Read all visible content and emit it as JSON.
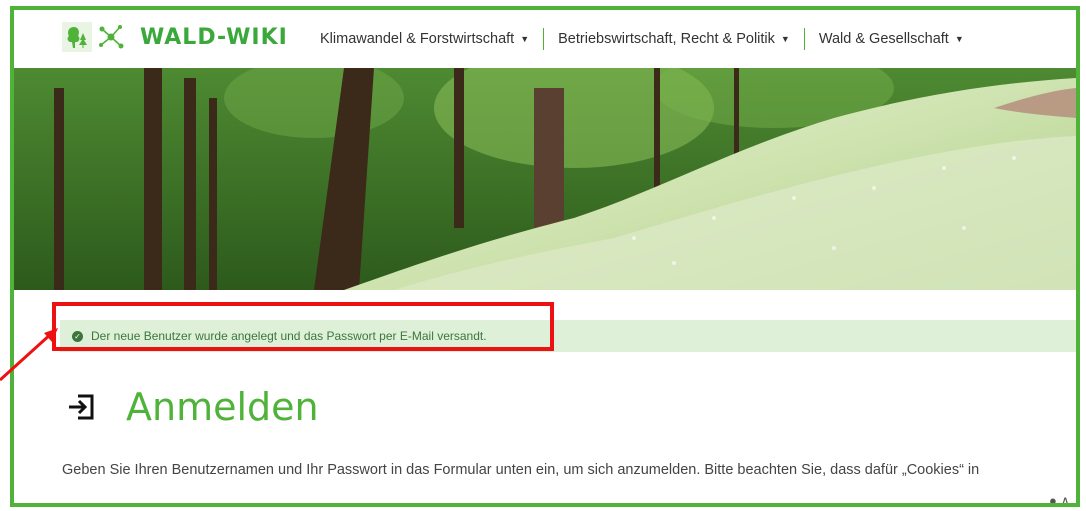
{
  "header": {
    "logo_text": "WALD-WIKI",
    "nav": [
      {
        "label": "Klimawandel & Forstwirtschaft"
      },
      {
        "label": "Betriebswirtschaft, Recht & Politik"
      },
      {
        "label": "Wald & Gesellschaft"
      }
    ]
  },
  "alert": {
    "message": "Der neue Benutzer wurde angelegt und das Passwort per E-Mail versandt."
  },
  "main": {
    "title": "Anmelden",
    "intro": "Geben Sie Ihren Benutzernamen und Ihr Passwort in das Formular unten ein, um sich anzumelden. Bitte beachten Sie, dass dafür „Cookies“ in"
  },
  "colors": {
    "frame": "#4fb33a",
    "brand_green": "#4fb33a",
    "alert_bg": "#dff0d8",
    "alert_text": "#3c763d",
    "annotation_red": "#ee1111"
  },
  "icons": {
    "logo_left": "tree-icon",
    "logo_right": "network-icon",
    "alert": "check-circle-icon",
    "heading": "login-icon",
    "nav_caret": "caret-down-icon"
  }
}
